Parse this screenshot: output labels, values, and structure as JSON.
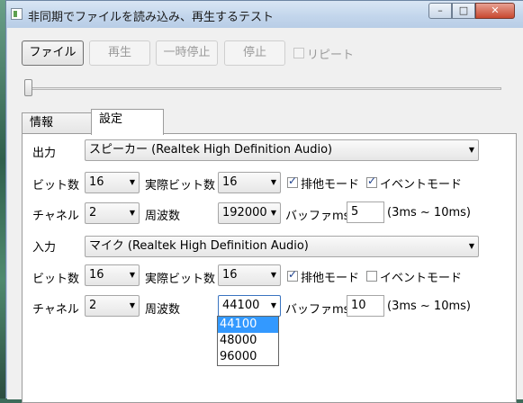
{
  "window": {
    "title": "非同期でファイルを読み込み、再生するテスト"
  },
  "titlebar": {
    "min": "–",
    "max": "□",
    "close": "✕"
  },
  "toolbar": {
    "file_label": "ファイル",
    "play_label": "再生",
    "pause_label": "一時停止",
    "stop_label": "停止",
    "repeat_label": "リピート",
    "repeat_checked": false
  },
  "seek": {
    "value": 0
  },
  "tabs": [
    {
      "label": "情報",
      "active": false
    },
    {
      "label": "設定",
      "active": true
    }
  ],
  "output": {
    "label": "出力",
    "device": "スピーカー (Realtek High Definition Audio)",
    "bits_label": "ビット数",
    "bits": "16",
    "actual_bits_label": "実際ビット数",
    "actual_bits": "16",
    "exclusive_label": "排他モード",
    "exclusive_checked": true,
    "event_label": "イベントモード",
    "event_checked": true,
    "channels_label": "チャネル",
    "channels": "2",
    "freq_label": "周波数",
    "freq": "192000",
    "buffer_label": "バッファms",
    "buffer": "5",
    "buffer_range": "(3ms ~ 10ms)"
  },
  "input": {
    "label": "入力",
    "device": "マイク (Realtek High Definition Audio)",
    "bits_label": "ビット数",
    "bits": "16",
    "actual_bits_label": "実際ビット数",
    "actual_bits": "16",
    "exclusive_label": "排他モード",
    "exclusive_checked": true,
    "event_label": "イベントモード",
    "event_checked": false,
    "channels_label": "チャネル",
    "channels": "2",
    "freq_label": "周波数",
    "freq": "44100",
    "buffer_label": "バッファms",
    "buffer": "10",
    "buffer_range": "(3ms ~ 10ms)"
  },
  "freq_dropdown": {
    "options": [
      "44100",
      "48000",
      "96000"
    ],
    "selected": "44100"
  }
}
